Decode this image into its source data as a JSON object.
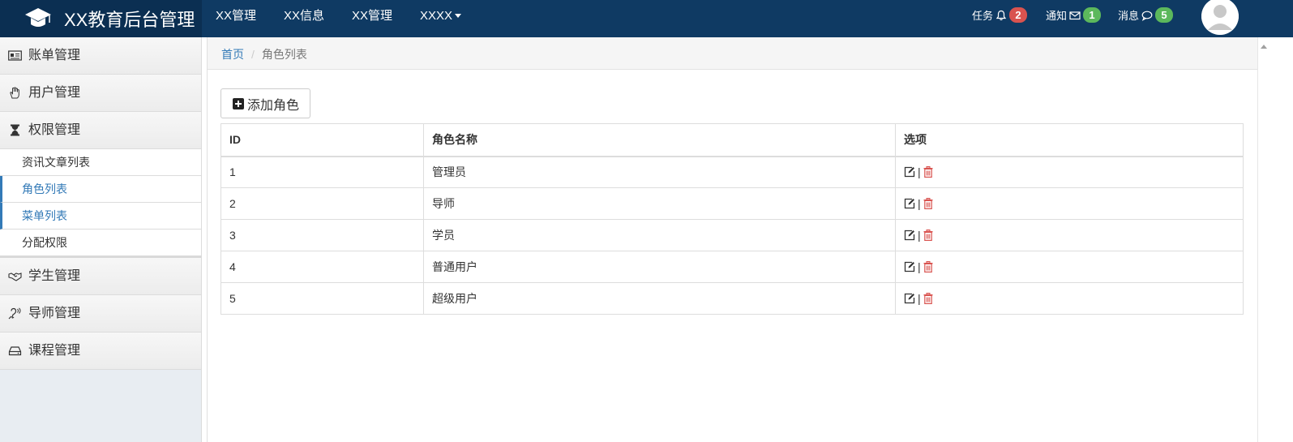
{
  "app": {
    "title": "XX教育后台管理"
  },
  "nav": {
    "items": [
      {
        "label": "XX管理"
      },
      {
        "label": "XX信息"
      },
      {
        "label": "XX管理"
      },
      {
        "label": "XXXX"
      }
    ]
  },
  "header_right": {
    "tasks": {
      "label": "任务",
      "count": "2",
      "icon": "bell-icon"
    },
    "notices": {
      "label": "通知",
      "count": "1",
      "icon": "envelope-icon"
    },
    "messages": {
      "label": "消息",
      "count": "5",
      "icon": "comment-icon"
    }
  },
  "sidebar": {
    "items": [
      {
        "label": "账单管理",
        "icon": "id-card-icon"
      },
      {
        "label": "用户管理",
        "icon": "hand-icon"
      },
      {
        "label": "权限管理",
        "icon": "hourglass-icon"
      },
      {
        "label": "学生管理",
        "icon": "handshake-icon"
      },
      {
        "label": "导师管理",
        "icon": "assistive-listening-icon"
      },
      {
        "label": "课程管理",
        "icon": "hdd-icon"
      }
    ],
    "subitems": [
      {
        "label": "资讯文章列表",
        "active": false
      },
      {
        "label": "角色列表",
        "active": true
      },
      {
        "label": "菜单列表",
        "active": true
      },
      {
        "label": "分配权限",
        "active": false
      }
    ]
  },
  "breadcrumb": {
    "home": "首页",
    "separator": "/",
    "current": "角色列表"
  },
  "toolbar": {
    "add_label": "添加角色"
  },
  "table": {
    "headers": [
      "ID",
      "角色名称",
      "选项"
    ],
    "rows": [
      {
        "id": "1",
        "name": "管理员"
      },
      {
        "id": "2",
        "name": "导师"
      },
      {
        "id": "3",
        "name": "学员"
      },
      {
        "id": "4",
        "name": "普通用户"
      },
      {
        "id": "5",
        "name": "超级用户"
      }
    ],
    "op_separator": "|"
  },
  "colors": {
    "topbar": "#0f3a63",
    "brand_bg": "#0b2f52",
    "link": "#337ab7",
    "badge_red": "#d9534f",
    "badge_green": "#5cb85c",
    "delete": "#d9534f"
  }
}
